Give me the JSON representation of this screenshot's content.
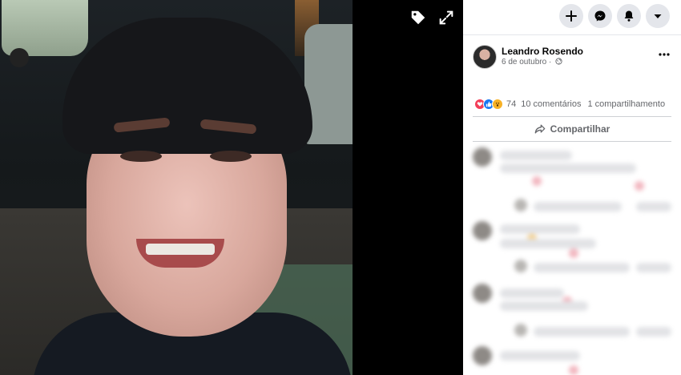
{
  "viewer": {
    "photo_description_icon": "selfie-photo",
    "tag_icon": "tag-icon",
    "fullscreen_icon": "expand-icon"
  },
  "topbar": {
    "buttons": [
      "plus-icon",
      "messenger-icon",
      "bell-icon",
      "caret-down-icon"
    ]
  },
  "post": {
    "author": "Leandro Rosendo",
    "date": "6 de outubro",
    "date_separator": "·",
    "privacy_icon": "globe-icon",
    "more_icon": "ellipsis-icon"
  },
  "reactions": {
    "types": [
      "love",
      "like",
      "wow"
    ],
    "count": "74",
    "comments": "10 comentários",
    "shares": "1 compartilhamento"
  },
  "actions": {
    "share_label": "Compartilhar"
  },
  "colors": {
    "love": "#f33e58",
    "like": "#1877f2",
    "wow": "#f7b125",
    "secondary_text": "#65676b",
    "button_bg": "#e4e6eb"
  }
}
